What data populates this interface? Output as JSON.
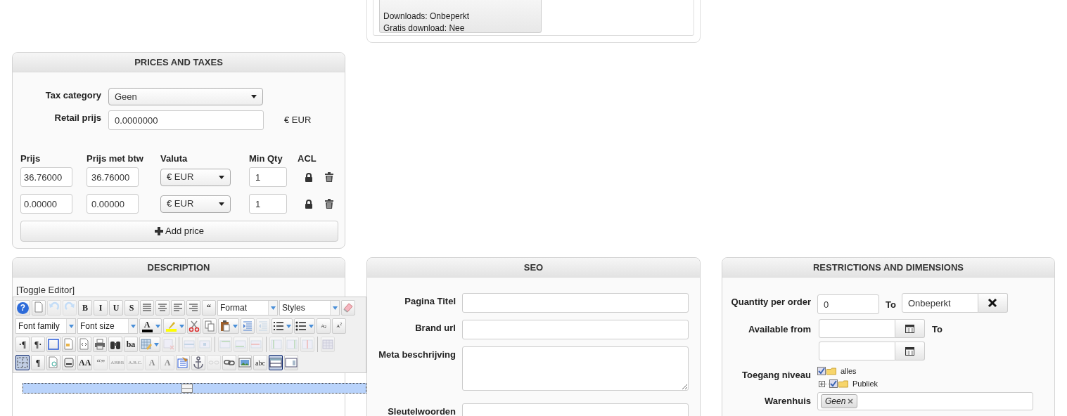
{
  "download_panel": {
    "lines": [
      "Downloads: Onbeperkt",
      "Gratis download: Nee"
    ]
  },
  "prices": {
    "title": "PRICES AND TAXES",
    "tax_category": {
      "label": "Tax category",
      "value": "Geen"
    },
    "retail_price": {
      "label": "Retail prijs",
      "value": "0.0000000",
      "currency": "€ EUR"
    },
    "columns": [
      "Prijs",
      "Prijs met btw",
      "Valuta",
      "Min Qty",
      "ACL"
    ],
    "rows": [
      {
        "price": "36.76000",
        "price_with_tax": "36.76000",
        "currency": "€ EUR",
        "min_qty": "1"
      },
      {
        "price": "0.00000",
        "price_with_tax": "0.00000",
        "currency": "€ EUR",
        "min_qty": "1"
      }
    ],
    "add_button": "Add price"
  },
  "description": {
    "title": "DESCRIPTION",
    "toggle": "[Toggle Editor]",
    "toolbar": [
      [
        {
          "kind": "glyph",
          "text": "?",
          "disabled": false,
          "selected": false
        },
        {
          "kind": "icon",
          "disabled": false,
          "selected": false
        },
        {
          "kind": "icon",
          "disabled": true,
          "selected": false
        },
        {
          "kind": "icon",
          "disabled": true,
          "selected": false
        },
        {
          "kind": "glyph",
          "text": "B",
          "disabled": false,
          "selected": false
        },
        {
          "kind": "glyph",
          "text": "I",
          "disabled": false,
          "selected": false
        },
        {
          "kind": "glyph",
          "text": "U",
          "disabled": false,
          "selected": false
        },
        {
          "kind": "glyph",
          "text": "S",
          "disabled": false,
          "selected": false
        },
        {
          "kind": "icon",
          "disabled": false,
          "selected": false
        },
        {
          "kind": "icon",
          "disabled": false,
          "selected": false
        },
        {
          "kind": "icon",
          "disabled": false,
          "selected": false
        },
        {
          "kind": "icon",
          "disabled": false,
          "selected": false
        },
        {
          "kind": "glyph",
          "text": "“",
          "disabled": false,
          "selected": false
        },
        {
          "kind": "dropdown",
          "text": "Format"
        },
        {
          "kind": "dropdown",
          "text": "Styles"
        },
        {
          "kind": "icon",
          "disabled": false,
          "selected": false
        }
      ],
      [
        {
          "kind": "dropdown",
          "text": "Font family"
        },
        {
          "kind": "dropdown",
          "text": "Font size"
        },
        {
          "kind": "color",
          "text": "A",
          "color": "#000000"
        },
        {
          "kind": "color",
          "color": "#ffff00"
        },
        {
          "kind": "icon",
          "disabled": false,
          "selected": false
        },
        {
          "kind": "icon",
          "disabled": false,
          "selected": false
        },
        {
          "kind": "split",
          "disabled": false,
          "selected": false
        },
        {
          "kind": "icon",
          "disabled": false,
          "selected": false
        },
        {
          "kind": "icon",
          "disabled": true,
          "selected": false
        },
        {
          "kind": "split",
          "disabled": false,
          "selected": false
        },
        {
          "kind": "split",
          "disabled": false,
          "selected": false
        },
        {
          "kind": "glyph",
          "text": "A$_{2}$",
          "disabled": false,
          "selected": false
        },
        {
          "kind": "glyph",
          "text": "A$^{2}$",
          "disabled": false,
          "selected": false
        }
      ],
      [
        {
          "kind": "glyph",
          "text": "·¶",
          "disabled": false,
          "selected": false
        },
        {
          "kind": "glyph",
          "text": "¶·",
          "disabled": false,
          "selected": false
        },
        {
          "kind": "icon",
          "disabled": false,
          "selected": false
        },
        {
          "kind": "icon",
          "disabled": false,
          "selected": false
        },
        {
          "kind": "icon",
          "disabled": false,
          "selected": false
        },
        {
          "kind": "icon",
          "disabled": false,
          "selected": false
        },
        {
          "kind": "icon",
          "disabled": false,
          "selected": false
        },
        {
          "kind": "glyph",
          "text": "ba",
          "disabled": false,
          "selected": false
        },
        {
          "kind": "split",
          "disabled": false,
          "selected": false
        },
        {
          "kind": "icon",
          "disabled": true,
          "selected": false
        },
        {
          "kind": "separator"
        },
        {
          "kind": "icon",
          "disabled": true,
          "selected": false
        },
        {
          "kind": "icon",
          "disabled": true,
          "selected": false
        },
        {
          "kind": "separator"
        },
        {
          "kind": "icon",
          "disabled": true,
          "selected": false
        },
        {
          "kind": "icon",
          "disabled": true,
          "selected": false
        },
        {
          "kind": "icon",
          "disabled": true,
          "selected": false
        },
        {
          "kind": "separator"
        },
        {
          "kind": "icon",
          "disabled": true,
          "selected": false
        },
        {
          "kind": "icon",
          "disabled": true,
          "selected": false
        },
        {
          "kind": "icon",
          "disabled": true,
          "selected": false
        },
        {
          "kind": "separator"
        },
        {
          "kind": "icon",
          "disabled": true,
          "selected": false
        }
      ],
      [
        {
          "kind": "icon",
          "disabled": false,
          "selected": true
        },
        {
          "kind": "glyph",
          "text": "¶",
          "disabled": false,
          "selected": false
        },
        {
          "kind": "icon",
          "disabled": false,
          "selected": false
        },
        {
          "kind": "icon",
          "disabled": false,
          "selected": false
        },
        {
          "kind": "glyph",
          "text": "AA",
          "disabled": false,
          "selected": false
        },
        {
          "kind": "glyph",
          "text": "“”",
          "disabled": true,
          "selected": false
        },
        {
          "kind": "glyph",
          "text": "ABBR",
          "disabled": true,
          "selected": false
        },
        {
          "kind": "glyph",
          "text": "A.B.C.",
          "disabled": true,
          "selected": false
        },
        {
          "kind": "glyph",
          "text": "A",
          "disabled": true,
          "selected": false
        },
        {
          "kind": "glyph",
          "text": "A",
          "disabled": true,
          "selected": false
        },
        {
          "kind": "icon",
          "disabled": false,
          "selected": false
        },
        {
          "kind": "icon",
          "disabled": false,
          "selected": false
        },
        {
          "kind": "icon",
          "disabled": true,
          "selected": false
        },
        {
          "kind": "icon",
          "disabled": false,
          "selected": false
        },
        {
          "kind": "icon",
          "disabled": false,
          "selected": false
        },
        {
          "kind": "glyph",
          "text": "abc",
          "disabled": false,
          "selected": false
        },
        {
          "kind": "icon",
          "disabled": false,
          "selected": true
        },
        {
          "kind": "icon",
          "disabled": false,
          "selected": false
        }
      ]
    ]
  },
  "seo": {
    "title": "SEO",
    "fields": [
      {
        "label": "Pagina Titel",
        "kind": "input"
      },
      {
        "label": "Brand url",
        "kind": "input"
      },
      {
        "label": "Meta beschrijving",
        "kind": "textarea"
      },
      {
        "label": "Sleutelwoorden",
        "kind": "input"
      }
    ]
  },
  "restrictions": {
    "title": "RESTRICTIONS AND DIMENSIONS",
    "quantity": {
      "label": "Quantity per order",
      "from": "0",
      "to_label": "To",
      "to": "Onbeperkt"
    },
    "available": {
      "label": "Available from",
      "to_label": "To"
    },
    "access": {
      "label": "Toegang niveau",
      "tree": [
        {
          "label": "alles",
          "checked": true,
          "children": [
            {
              "label": "Publiek",
              "checked": true
            }
          ]
        }
      ]
    },
    "warehouse": {
      "label": "Warenhuis",
      "tags": [
        "Geen"
      ]
    }
  }
}
